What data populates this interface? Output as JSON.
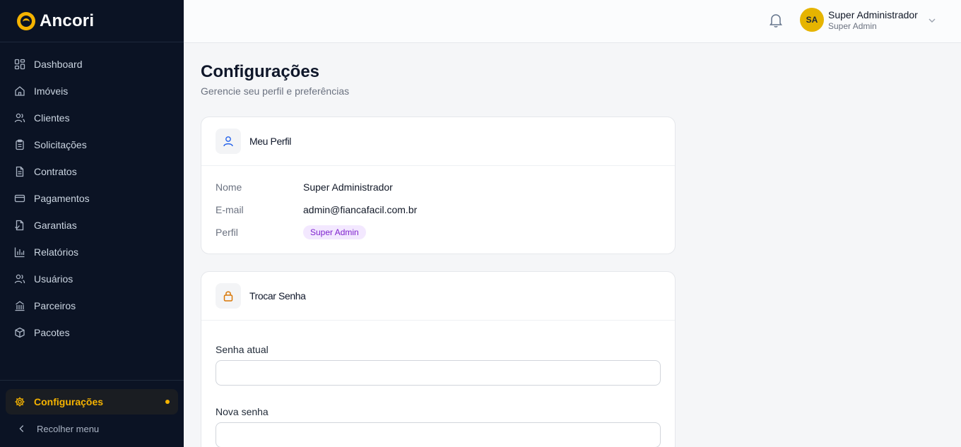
{
  "brand": {
    "name": "Ancori",
    "accent": "#f5b300"
  },
  "sidebar": {
    "items": [
      {
        "label": "Dashboard",
        "icon": "grid-icon"
      },
      {
        "label": "Imóveis",
        "icon": "home-icon"
      },
      {
        "label": "Clientes",
        "icon": "users-icon"
      },
      {
        "label": "Solicitações",
        "icon": "clipboard-icon"
      },
      {
        "label": "Contratos",
        "icon": "file-text-icon"
      },
      {
        "label": "Pagamentos",
        "icon": "credit-card-icon"
      },
      {
        "label": "Garantias",
        "icon": "file-check-icon"
      },
      {
        "label": "Relatórios",
        "icon": "bar-chart-icon"
      },
      {
        "label": "Usuários",
        "icon": "user-group-icon"
      },
      {
        "label": "Parceiros",
        "icon": "building-icon"
      },
      {
        "label": "Pacotes",
        "icon": "package-icon"
      }
    ],
    "active": {
      "label": "Configurações",
      "icon": "gear-icon"
    },
    "collapse_label": "Recolher menu"
  },
  "topbar": {
    "user": {
      "initials": "SA",
      "name": "Super Administrador",
      "role": "Super Admin"
    }
  },
  "page": {
    "title": "Configurações",
    "subtitle": "Gerencie seu perfil e preferências"
  },
  "profile_card": {
    "title": "Meu Perfil",
    "fields": [
      {
        "label": "Nome",
        "value": "Super Administrador"
      },
      {
        "label": "E-mail",
        "value": "admin@fiancafacil.com.br"
      },
      {
        "label": "Perfil",
        "value": "Super Admin"
      }
    ]
  },
  "password_card": {
    "title": "Trocar Senha",
    "current_label": "Senha atual",
    "current_value": "",
    "new_label": "Nova senha",
    "new_value": ""
  }
}
